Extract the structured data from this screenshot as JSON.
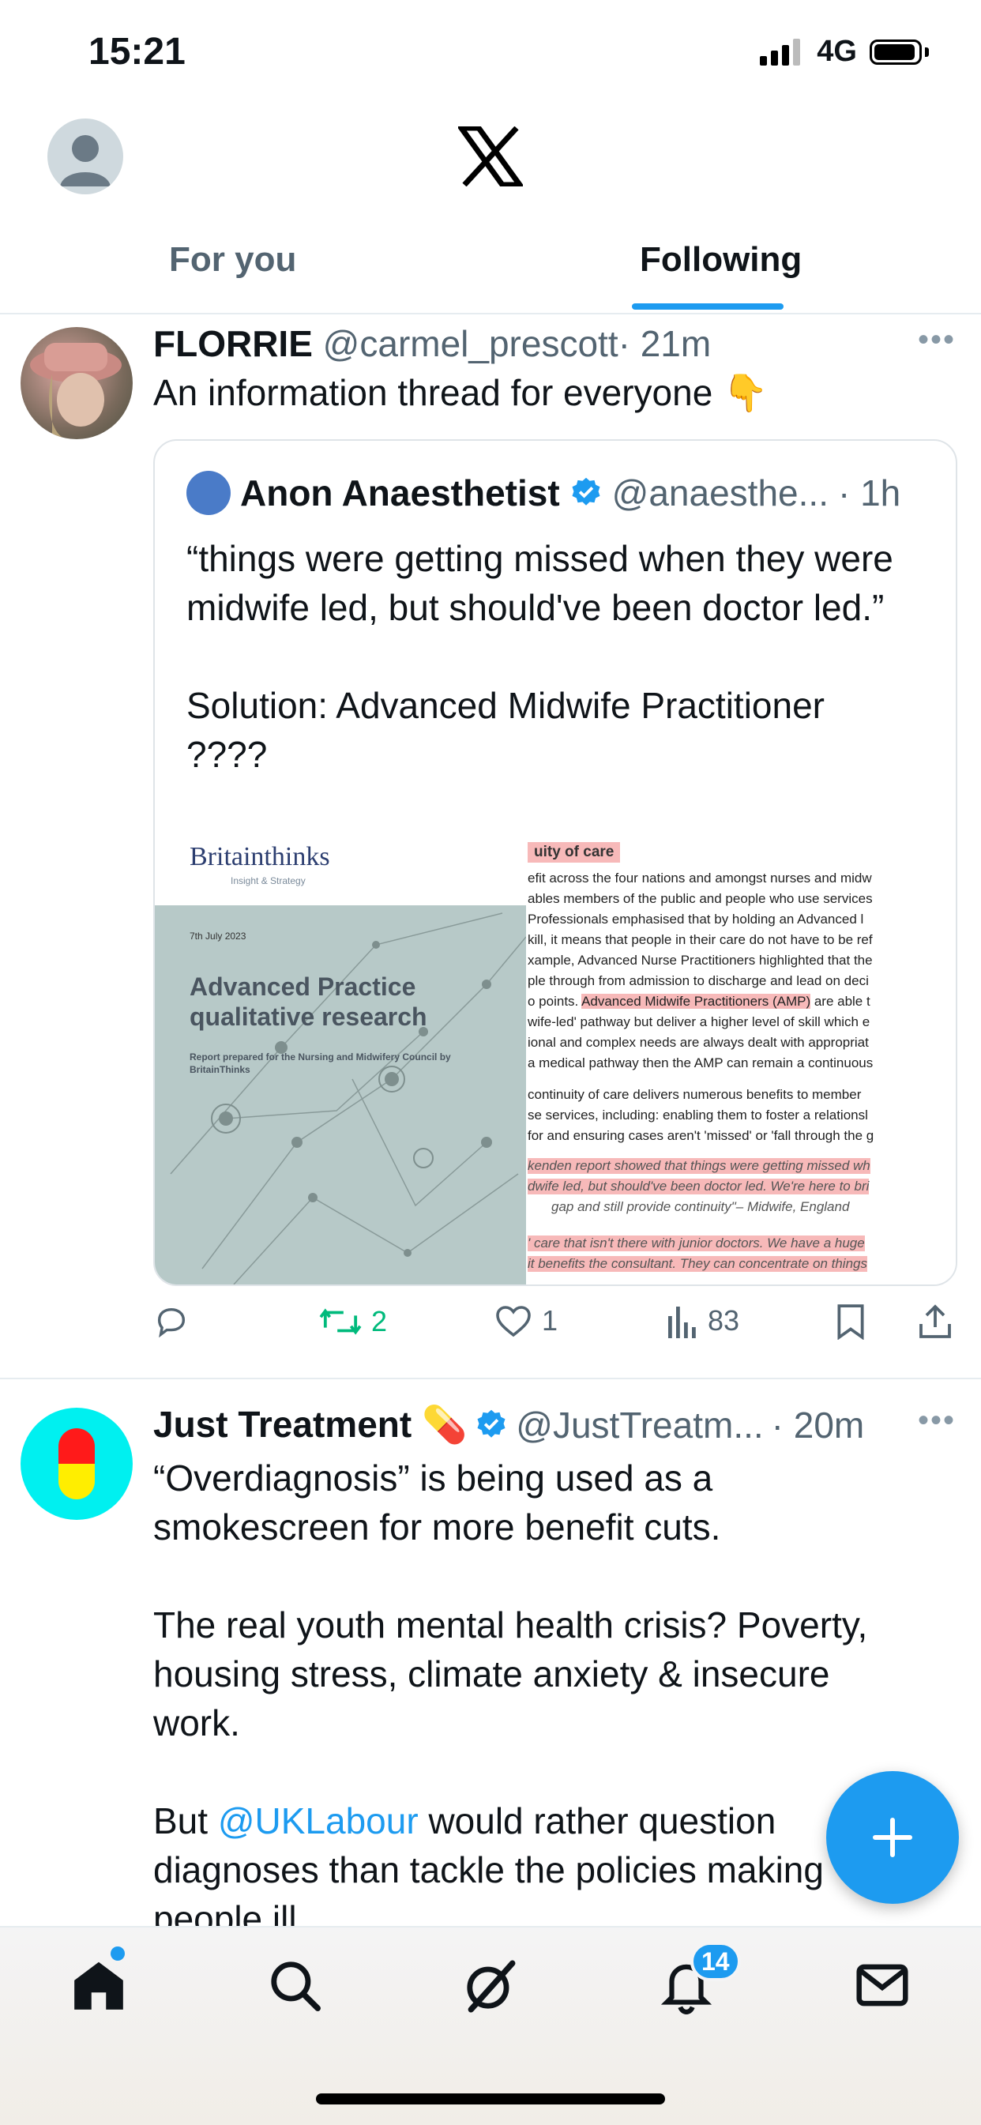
{
  "status_bar": {
    "time": "15:21",
    "network": "4G"
  },
  "tabs": [
    {
      "label": "For you"
    },
    {
      "label": "Following"
    }
  ],
  "tweet1": {
    "name": "FLORRIE",
    "handle": "@carmel_prescott",
    "time": "· 21m",
    "text": "An information thread for everyone 👇",
    "quote": {
      "name": "Anon Anaesthetist",
      "handle": "@anaesthe...",
      "time": "· 1h",
      "text": "“things were getting missed when they were midwife led, but should've been doctor led.”\n\nSolution: Advanced Midwife Practitioner ????",
      "image_left": {
        "brand": "Britainthinks",
        "brand_sub": "Insight & Strategy",
        "date": "7th July 2023",
        "title": "Advanced Practice qualitative research",
        "subtitle": "Report prepared for the Nursing and Midwifery Council by BritainThinks"
      },
      "image_right": {
        "heading": "uity of care",
        "lines": [
          "efit across the four nations and amongst nurses and midw",
          "ables members of the public and people who use services",
          " Professionals emphasised that by holding an Advanced l",
          "kill, it means that people in their care do not have to be ref",
          "xample, Advanced Nurse Practitioners highlighted that the",
          "ple through from admission to discharge and lead on deci",
          "o points.",
          "Advanced Midwife Practitioners (AMP)",
          " are able t",
          "wife-led' pathway but deliver a higher level of skill which e",
          "ional and complex needs are always dealt with appropriat",
          "a medical pathway then the AMP can remain a continuous",
          "continuity of care delivers numerous benefits to member",
          "se services, including: enabling them to foster a relationsl",
          "for and ensuring cases aren't 'missed' or 'fall through the g",
          "kenden report showed that things were getting missed wh",
          "dwife led, but should've been doctor led. We're here to bri",
          "gap and still provide continuity\"– Midwife, England",
          "' care that isn't there with junior doctors. We have a huge",
          "it benefits the consultant. They can concentrate on things"
        ]
      }
    },
    "actions": {
      "replies": "",
      "reposts": "2",
      "likes": "1",
      "views": "83"
    }
  },
  "tweet2": {
    "name": "Just Treatment 💊",
    "handle": "@JustTreatm...",
    "time": "· 20m",
    "text_before": "“Overdiagnosis” is being used as a smokescreen for more benefit cuts.\n\nThe real youth mental health crisis? Poverty, housing stress, climate anxiety & insecure work.\n\nBut ",
    "mention": "@UKLabour",
    "text_after": " would rather question diagnoses than tackle the policies making people ill."
  },
  "bottom_nav": {
    "notifications_badge": "14"
  },
  "icons": [
    "x-logo-icon",
    "verified-badge-icon",
    "reply-icon",
    "repost-icon",
    "like-icon",
    "views-icon",
    "bookmark-icon",
    "share-icon",
    "compose-plus-icon",
    "home-icon",
    "search-icon",
    "grok-icon",
    "notifications-icon",
    "messages-icon",
    "more-icon"
  ],
  "colors": {
    "accent": "#1d9bf0",
    "repost_green": "#00ba7c",
    "text_primary": "#0f1419",
    "text_secondary": "#536471"
  }
}
